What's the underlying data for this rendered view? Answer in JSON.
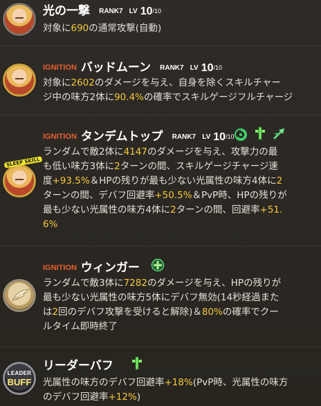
{
  "colors": {
    "background": "#2b2825",
    "highlight": "#f4c93b",
    "ignition": "#e6602d",
    "text": "#e5e0d8"
  },
  "skills": [
    {
      "name": "光の一撃",
      "rank": "RANK7",
      "lv_label": "LV",
      "lv": "10",
      "lv_max": "/10",
      "desc": [
        {
          "t": "対象に"
        },
        {
          "t": "690",
          "h": true
        },
        {
          "t": "の通常攻撃(自動)"
        }
      ]
    },
    {
      "tag": "IGNITION",
      "name": "バッドムーン",
      "rank": "RANK7",
      "lv_label": "LV",
      "lv": "10",
      "lv_max": "/10",
      "desc_lines": [
        [
          {
            "t": "対象に"
          },
          {
            "t": "2602",
            "h": true
          },
          {
            "t": "のダメージを与え、自身を除くスキルチャー"
          }
        ],
        [
          {
            "t": "ジ中の味方2体に"
          },
          {
            "t": "90.4%",
            "h": true
          },
          {
            "t": "の確率でスキルゲージフルチャージ"
          }
        ]
      ]
    },
    {
      "tag": "IGNITION",
      "name": "タンデムトップ",
      "rank": "RANK7",
      "lv_label": "LV",
      "lv": "10",
      "lv_max": "/10",
      "badge": "SLEEP SKILL",
      "icons": [
        "swirl-icon",
        "cross-heal-icon",
        "wing-arrow-icon"
      ],
      "desc_lines": [
        [
          {
            "t": "ランダムで敵2体に"
          },
          {
            "t": "4147",
            "h": true
          },
          {
            "t": "のダメージを与え、攻撃力の最"
          }
        ],
        [
          {
            "t": "も低い味方3体に"
          },
          {
            "t": "2",
            "h": true
          },
          {
            "t": "ターンの間、スキルゲージチャージ速"
          }
        ],
        [
          {
            "t": "度"
          },
          {
            "t": "+93.5%",
            "h": true
          },
          {
            "t": "＆HPの残りが最も少ない光属性の味方4体に"
          },
          {
            "t": "2",
            "h": true
          }
        ],
        [
          {
            "t": "ターンの間、デバフ回避率"
          },
          {
            "t": "+50.5%",
            "h": true
          },
          {
            "t": "＆PvP時、HPの残りが"
          }
        ],
        [
          {
            "t": "最も少ない光属性の味方4体に"
          },
          {
            "t": "2",
            "h": true
          },
          {
            "t": "ターンの間、回避率"
          },
          {
            "t": "+51.",
            "h": true
          }
        ],
        [
          {
            "t": "6%",
            "h": true
          }
        ]
      ]
    },
    {
      "tag": "IGNITION",
      "name": "ウィンガー",
      "icons": [
        "plus-shield-icon"
      ],
      "desc_lines": [
        [
          {
            "t": "ランダムで敵3体に"
          },
          {
            "t": "7282",
            "h": true
          },
          {
            "t": "のダメージを与え、HPの残りが"
          }
        ],
        [
          {
            "t": "最も少ない光属性の味方5体にデバフ無効(14秒経過また"
          }
        ],
        [
          {
            "t": "は"
          },
          {
            "t": "2",
            "h": true
          },
          {
            "t": "回のデバフ攻撃を受けると解除)＆"
          },
          {
            "t": "80%",
            "h": true
          },
          {
            "t": "の確率でクー"
          }
        ],
        [
          {
            "t": "ルタイム即時終了"
          }
        ]
      ]
    },
    {
      "name": "リーダーバフ",
      "leader_top": "LEADER",
      "leader_bottom": "BUFF",
      "icons": [
        "cross-heal-icon"
      ],
      "desc_lines": [
        [
          {
            "t": "光属性の味方のデバフ回避率"
          },
          {
            "t": "+18%",
            "h": true
          },
          {
            "t": "(PvP時、光属性の味方"
          }
        ],
        [
          {
            "t": "のデバフ回避率"
          },
          {
            "t": "+12%",
            "h": true
          },
          {
            "t": ")"
          }
        ]
      ]
    }
  ]
}
